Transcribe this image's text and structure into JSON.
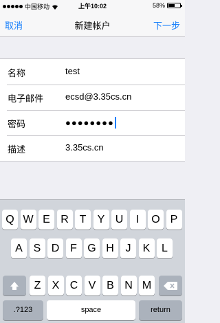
{
  "status_bar": {
    "carrier": "中国移动",
    "time": "上午10:02",
    "battery_label": "58%",
    "battery_level": 0.58
  },
  "nav": {
    "cancel_label": "取消",
    "title": "新建帐户",
    "next_label": "下一步"
  },
  "form": {
    "rows": [
      {
        "label": "名称",
        "value": "test"
      },
      {
        "label": "电子邮件",
        "value": "ecsd@3.35cs.cn"
      },
      {
        "label": "密码",
        "value": "●●●●●●●●"
      },
      {
        "label": "描述",
        "value": "3.35cs.cn"
      }
    ]
  },
  "keyboard": {
    "row1": [
      "Q",
      "W",
      "E",
      "R",
      "T",
      "Y",
      "U",
      "I",
      "O",
      "P"
    ],
    "row2": [
      "A",
      "S",
      "D",
      "F",
      "G",
      "H",
      "J",
      "K",
      "L"
    ],
    "row3": [
      "Z",
      "X",
      "C",
      "V",
      "B",
      "N",
      "M"
    ],
    "numbers_label": ".?123",
    "space_label": "space",
    "return_label": "return"
  },
  "colors": {
    "accent": "#157efb",
    "background": "#efeff4",
    "keyboard_bg": "#d1d5db"
  }
}
